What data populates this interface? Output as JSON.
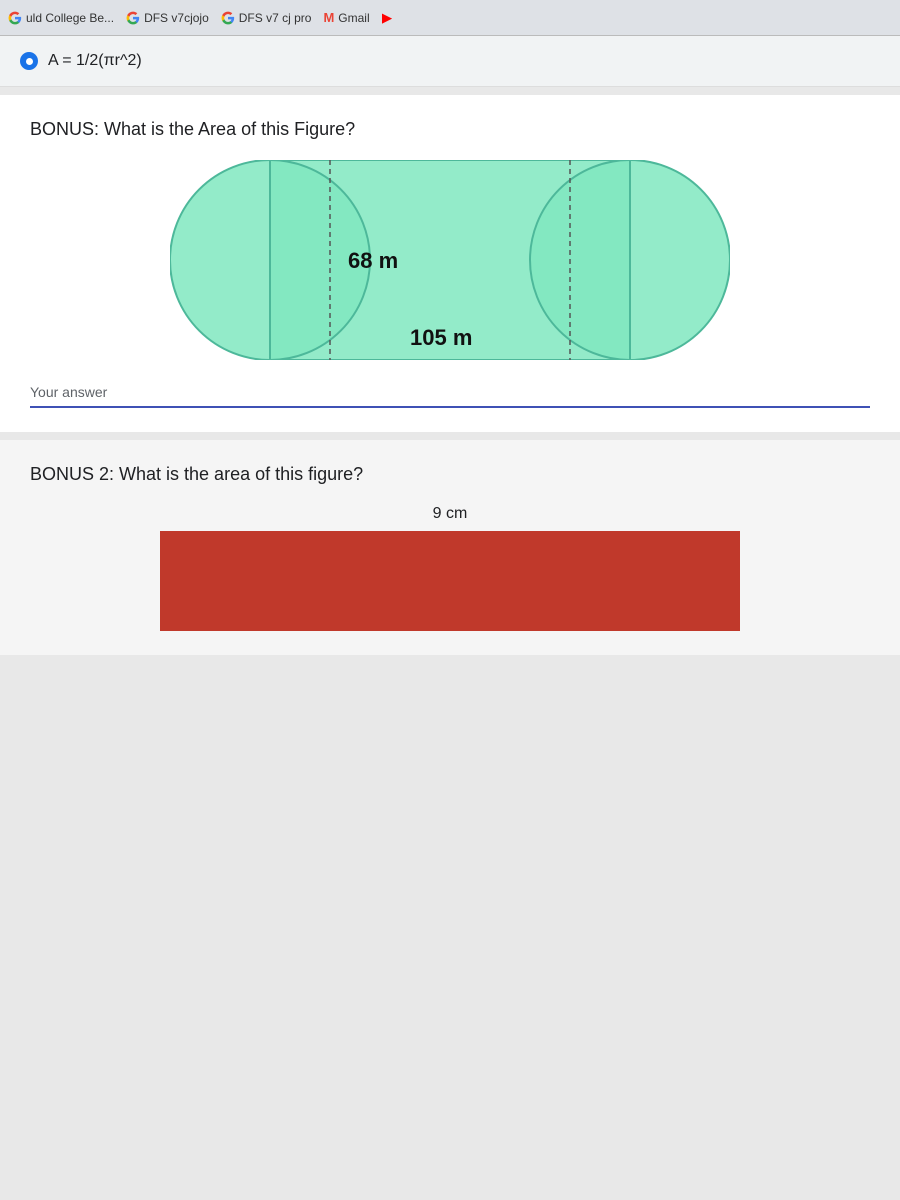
{
  "tabbar": {
    "tab1": {
      "label": "uld College Be...",
      "icon": "google-icon"
    },
    "tab2": {
      "label": "DFS v7cjojo",
      "icon": "google-icon"
    },
    "tab3": {
      "label": "DFS v7 cj pro",
      "icon": "google-icon"
    },
    "tab4": {
      "label": "Gmail",
      "icon": "gmail-icon"
    }
  },
  "radio_option": {
    "label": "A = 1/2(πr^2)"
  },
  "bonus1": {
    "title": "BONUS: What is the Area of this Figure?",
    "figure": {
      "height_label": "68 m",
      "width_label": "105 m"
    },
    "answer_placeholder": "Your answer"
  },
  "bonus2": {
    "title": "BONUS 2: What is the area of this figure?",
    "figure": {
      "label": "9 cm"
    }
  }
}
